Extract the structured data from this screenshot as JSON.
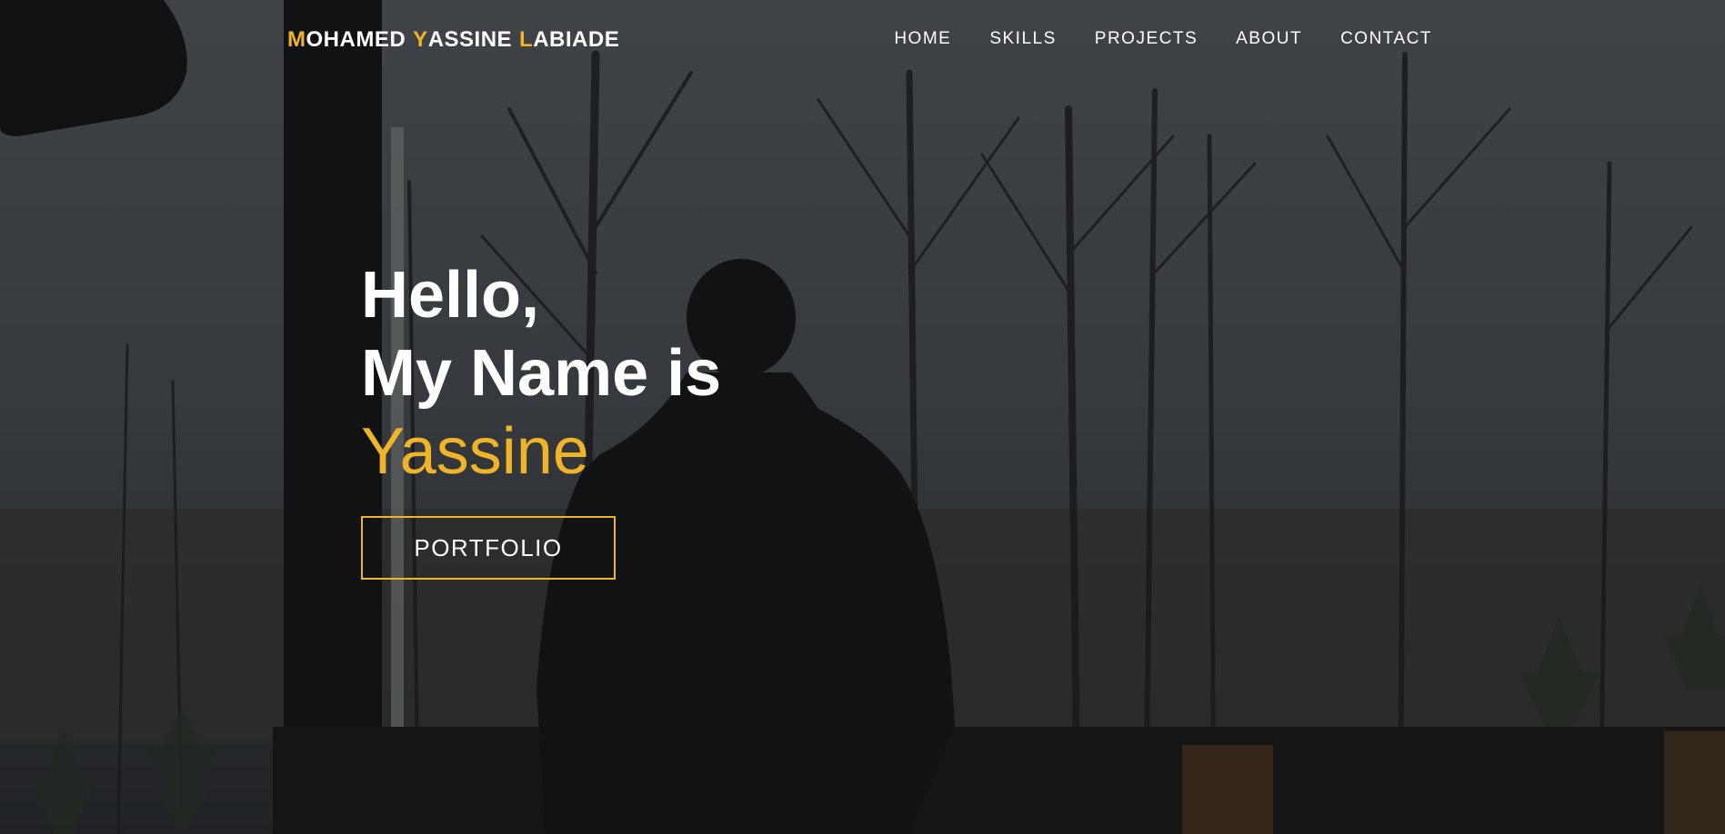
{
  "brand": {
    "words": [
      {
        "initial": "M",
        "rest": "OHAMED"
      },
      {
        "initial": "Y",
        "rest": "ASSINE"
      },
      {
        "initial": "L",
        "rest": "ABIADE"
      }
    ]
  },
  "nav": {
    "items": [
      {
        "label": "HOME"
      },
      {
        "label": "SKILLS"
      },
      {
        "label": "PROJECTS"
      },
      {
        "label": "ABOUT"
      },
      {
        "label": "CONTACT"
      }
    ]
  },
  "hero": {
    "greeting": "Hello,",
    "name_line": "My Name is",
    "first_name": "Yassine",
    "cta_label": "PORTFOLIO"
  },
  "colors": {
    "accent": "#f0b429",
    "text": "#ffffff"
  }
}
